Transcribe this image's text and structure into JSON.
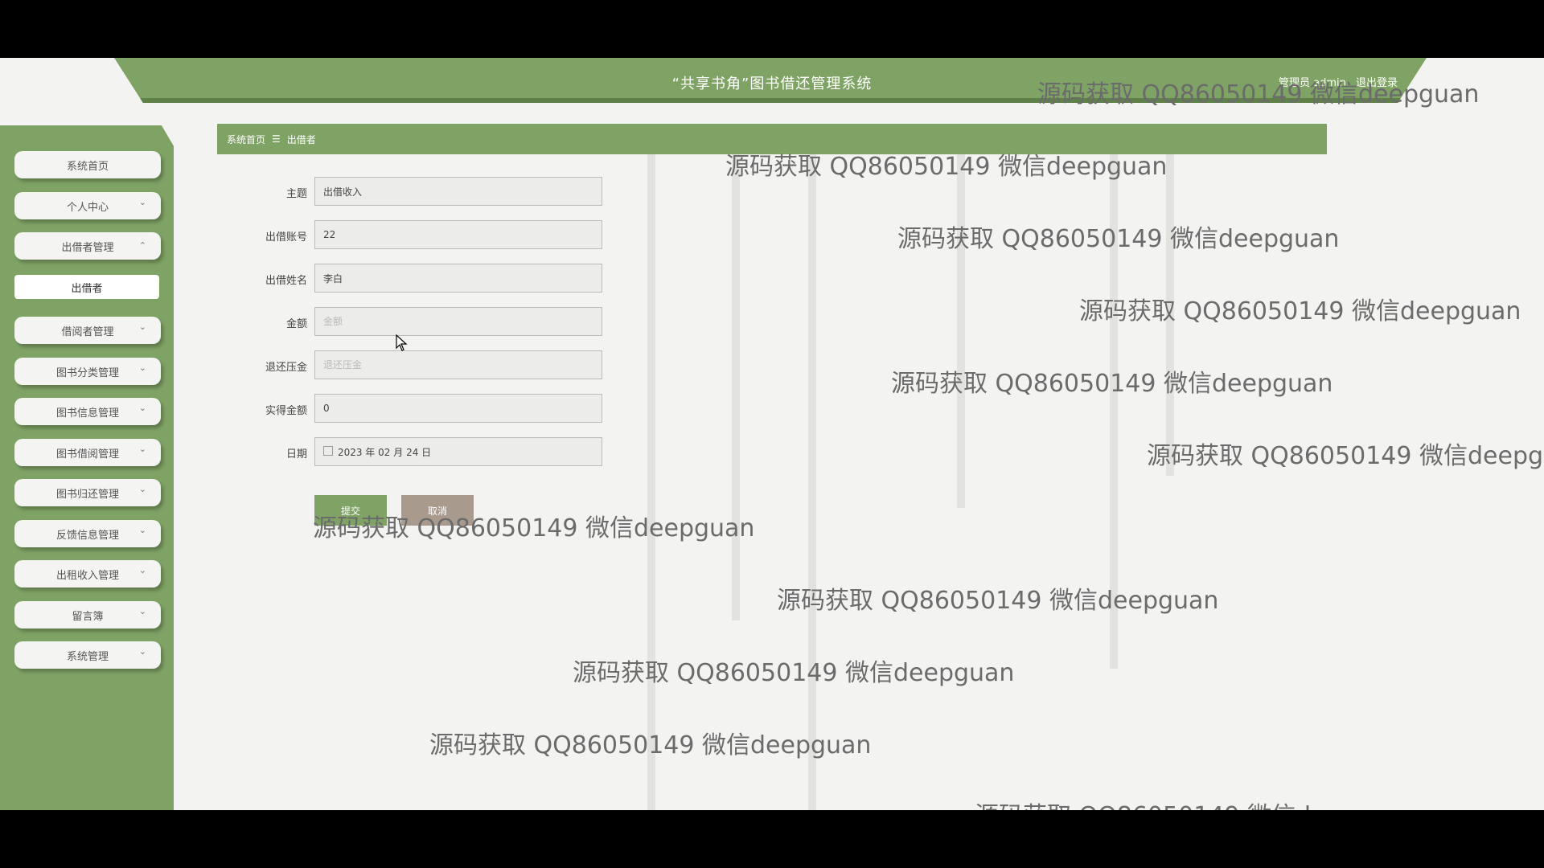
{
  "header": {
    "title": "“共享书角”图书借还管理系统",
    "user_label": "管理员 admin",
    "logout_label": "退出登录"
  },
  "sidebar": {
    "items": [
      {
        "label": "系统首页"
      },
      {
        "label": "个人中心",
        "chevron": "⌄"
      },
      {
        "label": "出借者管理",
        "chevron": "⌃"
      },
      {
        "label": "出借者"
      },
      {
        "label": "借阅者管理",
        "chevron": "⌄"
      },
      {
        "label": "图书分类管理",
        "chevron": "⌄"
      },
      {
        "label": "图书信息管理",
        "chevron": "⌄"
      },
      {
        "label": "图书借阅管理",
        "chevron": "⌄"
      },
      {
        "label": "图书归还管理",
        "chevron": "⌄"
      },
      {
        "label": "反馈信息管理",
        "chevron": "⌄"
      },
      {
        "label": "出租收入管理",
        "chevron": "⌄"
      },
      {
        "label": "留言簿",
        "chevron": "⌄"
      },
      {
        "label": "系统管理",
        "chevron": "⌄"
      }
    ]
  },
  "breadcrumb": {
    "home": "系统首页",
    "separator": "☰",
    "current": "出借者"
  },
  "form": {
    "fields": [
      {
        "label": "主题",
        "value": "出借收入",
        "placeholder": ""
      },
      {
        "label": "出借账号",
        "value": "22",
        "placeholder": ""
      },
      {
        "label": "出借姓名",
        "value": "李白",
        "placeholder": ""
      },
      {
        "label": "金额",
        "value": "",
        "placeholder": "金额"
      },
      {
        "label": "退还压金",
        "value": "",
        "placeholder": "退还压金"
      },
      {
        "label": "实得金额",
        "value": "0",
        "placeholder": ""
      },
      {
        "label": "日期",
        "value": "2023 年 02 月 24 日",
        "placeholder": ""
      }
    ],
    "submit_label": "提交",
    "cancel_label": "取消"
  },
  "watermark": {
    "text": "源码获取 QQ86050149 微信deepguan"
  },
  "colors": {
    "accent": "#7fa365",
    "cancel": "#a89b8e",
    "background": "#f3f3f1"
  }
}
